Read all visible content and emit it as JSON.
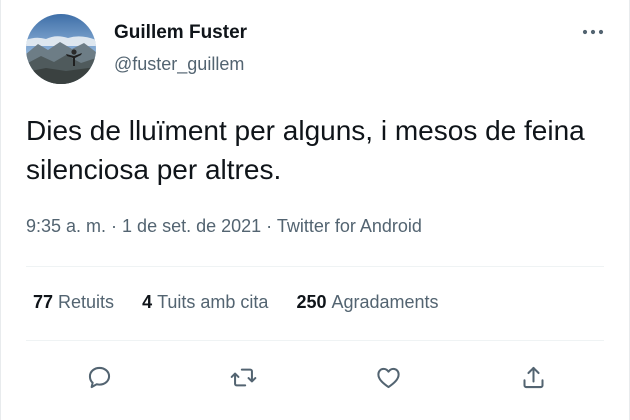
{
  "user": {
    "name": "Guillem Fuster",
    "handle": "@fuster_guillem"
  },
  "tweet": {
    "text": "Dies de lluïment per alguns, i mesos de feina silenciosa per altres."
  },
  "meta": {
    "time": "9:35 a. m.",
    "sep1": " · ",
    "date": "1 de set. de 2021",
    "sep2": " · ",
    "source": "Twitter for Android"
  },
  "stats": {
    "retweets_count": "77",
    "retweets_label": "Retuits",
    "quotes_count": "4",
    "quotes_label": "Tuits amb cita",
    "likes_count": "250",
    "likes_label": "Agradaments"
  },
  "icons": {
    "more": "more-icon",
    "reply": "reply-icon",
    "retweet": "retweet-icon",
    "like": "like-icon",
    "share": "share-icon"
  },
  "colors": {
    "text": "#0f1419",
    "secondary": "#536471",
    "divider": "#eff3f4"
  }
}
